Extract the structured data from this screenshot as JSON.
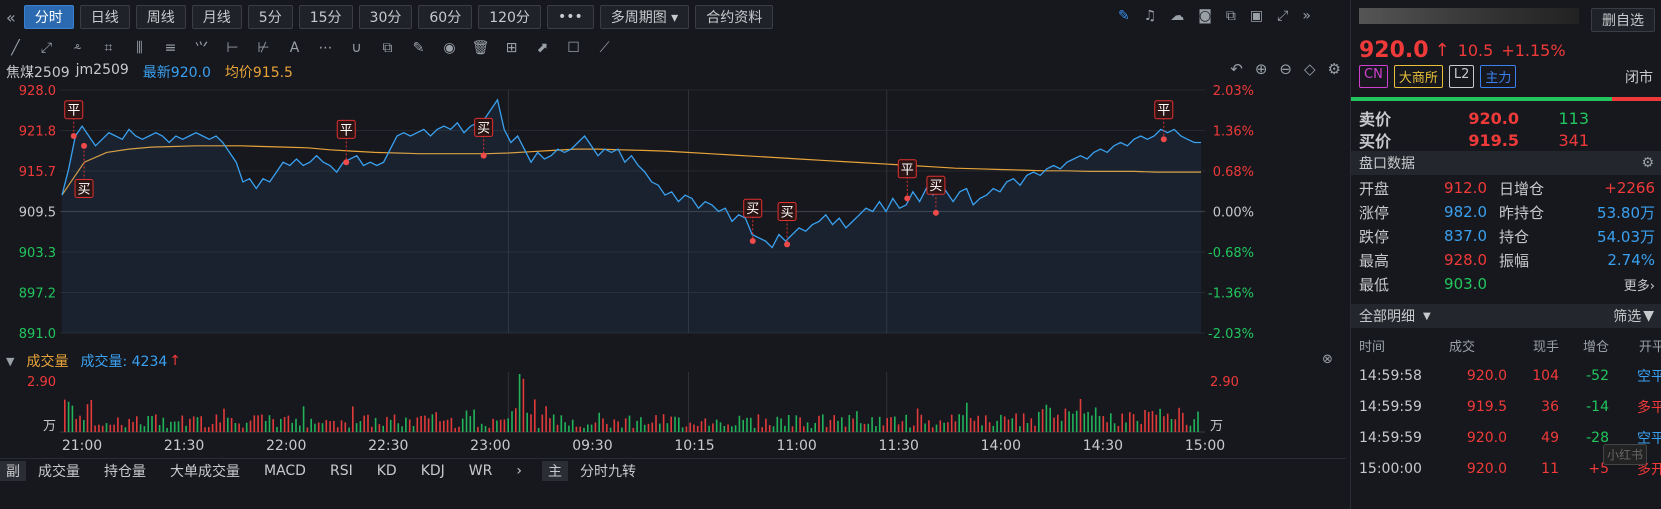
{
  "toolbar": {
    "left_icon": "«",
    "buttons": [
      "分时",
      "日线",
      "周线",
      "月线",
      "5分",
      "15分",
      "30分",
      "60分",
      "120分",
      "•••"
    ],
    "multi": "多周期图 ▾",
    "contract": "合约资料"
  },
  "draw_tools": [
    "╱",
    "⤢",
    "⸛",
    "⌗",
    "⫼",
    "≡",
    "⺍",
    "⊢",
    "⊬",
    "A",
    "⋯",
    "∪",
    "⧉",
    "✎",
    "◉",
    "🗑",
    "⊞",
    "⬈",
    "☐",
    "⟋"
  ],
  "header": {
    "name": "焦煤2509",
    "code": "jm2509",
    "latest_label": "最新920.0",
    "avg_label": "均价915.5"
  },
  "chart_data": {
    "type": "line",
    "y_ticks": [
      "928.0",
      "921.8",
      "915.7",
      "909.5",
      "903.3",
      "897.2",
      "891.0"
    ],
    "pct_ticks": [
      "2.03%",
      "1.36%",
      "0.68%",
      "0.00%",
      "-0.68%",
      "-1.36%",
      "-2.03%"
    ],
    "x_ticks": [
      "21:00",
      "21:30",
      "22:00",
      "22:30",
      "23:00",
      "09:30",
      "10:15",
      "11:00",
      "11:30",
      "14:00",
      "14:30",
      "15:00"
    ],
    "ylim": [
      891.0,
      928.0
    ],
    "prev_close": 909.5,
    "price_series": [
      912.0,
      916,
      921,
      922.5,
      921,
      919.5,
      920.5,
      921.5,
      921,
      920.5,
      922,
      921,
      920.5,
      921,
      921.5,
      921,
      920,
      921,
      920.5,
      921,
      921.5,
      921,
      920.5,
      921,
      920,
      918.5,
      917,
      914,
      914.5,
      913,
      914.5,
      914,
      915.5,
      917,
      916.5,
      917.5,
      916.5,
      917,
      918,
      917,
      916.5,
      915.5,
      917,
      917.5,
      918,
      916.5,
      917,
      916.5,
      917,
      919,
      921,
      921.5,
      921,
      921.5,
      922,
      921,
      922,
      922.5,
      922,
      923,
      921.5,
      922.5,
      923,
      923.5,
      925,
      926.5,
      922,
      920,
      921,
      919,
      917,
      918.5,
      917.5,
      918,
      919,
      918.5,
      919,
      920,
      921,
      919.5,
      918,
      919,
      918.5,
      919,
      917,
      918,
      916.5,
      915.5,
      914,
      913.5,
      912,
      912.5,
      911,
      912,
      911.5,
      910,
      911,
      910.5,
      909.5,
      910,
      908,
      909,
      908.5,
      906,
      905.5,
      905,
      904,
      906,
      905,
      906,
      907,
      906.5,
      907.5,
      908,
      909,
      907.5,
      908.5,
      907,
      908,
      909,
      910,
      909.5,
      911,
      909.5,
      911.5,
      910,
      910.5,
      912.5,
      911,
      913,
      912,
      914,
      912.5,
      911,
      912.5,
      913,
      910.5,
      911.5,
      912,
      913,
      912.5,
      914,
      914.5,
      913.5,
      915,
      915.5,
      915,
      916,
      916.5,
      916,
      917,
      917.5,
      918,
      917.5,
      918.5,
      919,
      918.5,
      919.5,
      920,
      919.5,
      920.5,
      921,
      920.5,
      921,
      922,
      921.5,
      922,
      921,
      920.5,
      920,
      920
    ],
    "avg_series": [
      912,
      917,
      918.5,
      919,
      919.3,
      919.4,
      919.5,
      919.5,
      919.5,
      919.4,
      919.3,
      919.2,
      918.9,
      918.7,
      918.5,
      918.4,
      918.3,
      918.3,
      918.3,
      918.3,
      918.4,
      918.6,
      918.8,
      919,
      919,
      918.9,
      918.8,
      918.7,
      918.5,
      918.3,
      918.1,
      917.9,
      917.7,
      917.5,
      917.3,
      917.1,
      916.9,
      916.7,
      916.5,
      916.3,
      916.1,
      916,
      915.9,
      915.8,
      915.7,
      915.7,
      915.6,
      915.6,
      915.6,
      915.5,
      915.5,
      915.5
    ],
    "volume_ylim": [
      0,
      2.9
    ],
    "volume_ticks": [
      "2.90",
      "万"
    ],
    "markers": [
      {
        "label": "平",
        "x_frac": 0.012,
        "y": 925.0,
        "dot": 921.0,
        "color": "#e03030"
      },
      {
        "label": "买",
        "x_frac": 0.021,
        "y": 913.0,
        "dot": 919.5,
        "color": "#e03030"
      },
      {
        "label": "平",
        "x_frac": 0.25,
        "y": 922.0,
        "dot": 917.0,
        "color": "#e03030"
      },
      {
        "label": "买",
        "x_frac": 0.37,
        "y": 922.3,
        "dot": 918.0,
        "color": "#e03030"
      },
      {
        "label": "买",
        "x_frac": 0.605,
        "y": 910.0,
        "dot": 905.0,
        "color": "#e03030"
      },
      {
        "label": "买",
        "x_frac": 0.635,
        "y": 909.5,
        "dot": 904.5,
        "color": "#e03030"
      },
      {
        "label": "平",
        "x_frac": 0.74,
        "y": 916.0,
        "dot": 911.5,
        "color": "#e03030"
      },
      {
        "label": "买",
        "x_frac": 0.765,
        "y": 913.5,
        "dot": 909.3,
        "color": "#e03030"
      },
      {
        "label": "平",
        "x_frac": 0.964,
        "y": 925.0,
        "dot": 920.5,
        "color": "#e03030"
      }
    ]
  },
  "volume_header": {
    "title": "成交量",
    "series": "成交量: 4234"
  },
  "bottom_tabs": [
    "副",
    "成交量",
    "持仓量",
    "大单成交量",
    "MACD",
    "RSI",
    "KD",
    "KDJ",
    "WR",
    "›",
    "主",
    "分时九转"
  ],
  "quote": {
    "price": "920.0",
    "arrow": "↑",
    "chg": "10.5",
    "pct": "+1.15%",
    "add_watch": "删自选",
    "status": "闭市"
  },
  "tags": [
    {
      "t": "CN",
      "c": "#d040d0"
    },
    {
      "t": "大商所",
      "c": "#e8c03a"
    },
    {
      "t": "L2",
      "c": "#c8c9cc"
    },
    {
      "t": "主力",
      "c": "#3a80f0"
    }
  ],
  "book": {
    "sell_label": "卖价",
    "sell_price": "920.0",
    "sell_vol": "113",
    "buy_label": "买价",
    "buy_price": "919.5",
    "buy_vol": "341"
  },
  "panel": {
    "title": "盘口数据",
    "more": "更多›",
    "rows": [
      [
        "开盘",
        "912.0",
        "日增仓",
        "+2266"
      ],
      [
        "涨停",
        "982.0",
        "昨持仓",
        "53.80万"
      ],
      [
        "跌停",
        "837.0",
        "持仓",
        "54.03万"
      ],
      [
        "最高",
        "928.0",
        "振幅",
        "2.74%"
      ],
      [
        "最低",
        "903.0",
        "",
        ""
      ]
    ]
  },
  "detail": {
    "title": "全部明细",
    "filter": "筛选",
    "headers": [
      "时间",
      "成交",
      "现手",
      "增仓",
      "开平"
    ],
    "rows": [
      [
        "14:59:58",
        "920.0",
        "104",
        "-52",
        "空平"
      ],
      [
        "14:59:59",
        "919.5",
        "36",
        "-14",
        "多平"
      ],
      [
        "14:59:59",
        "920.0",
        "49",
        "-28",
        "空平"
      ],
      [
        "15:00:00",
        "920.0",
        "11",
        "+5",
        "多开"
      ]
    ]
  },
  "watermark": "小红书"
}
